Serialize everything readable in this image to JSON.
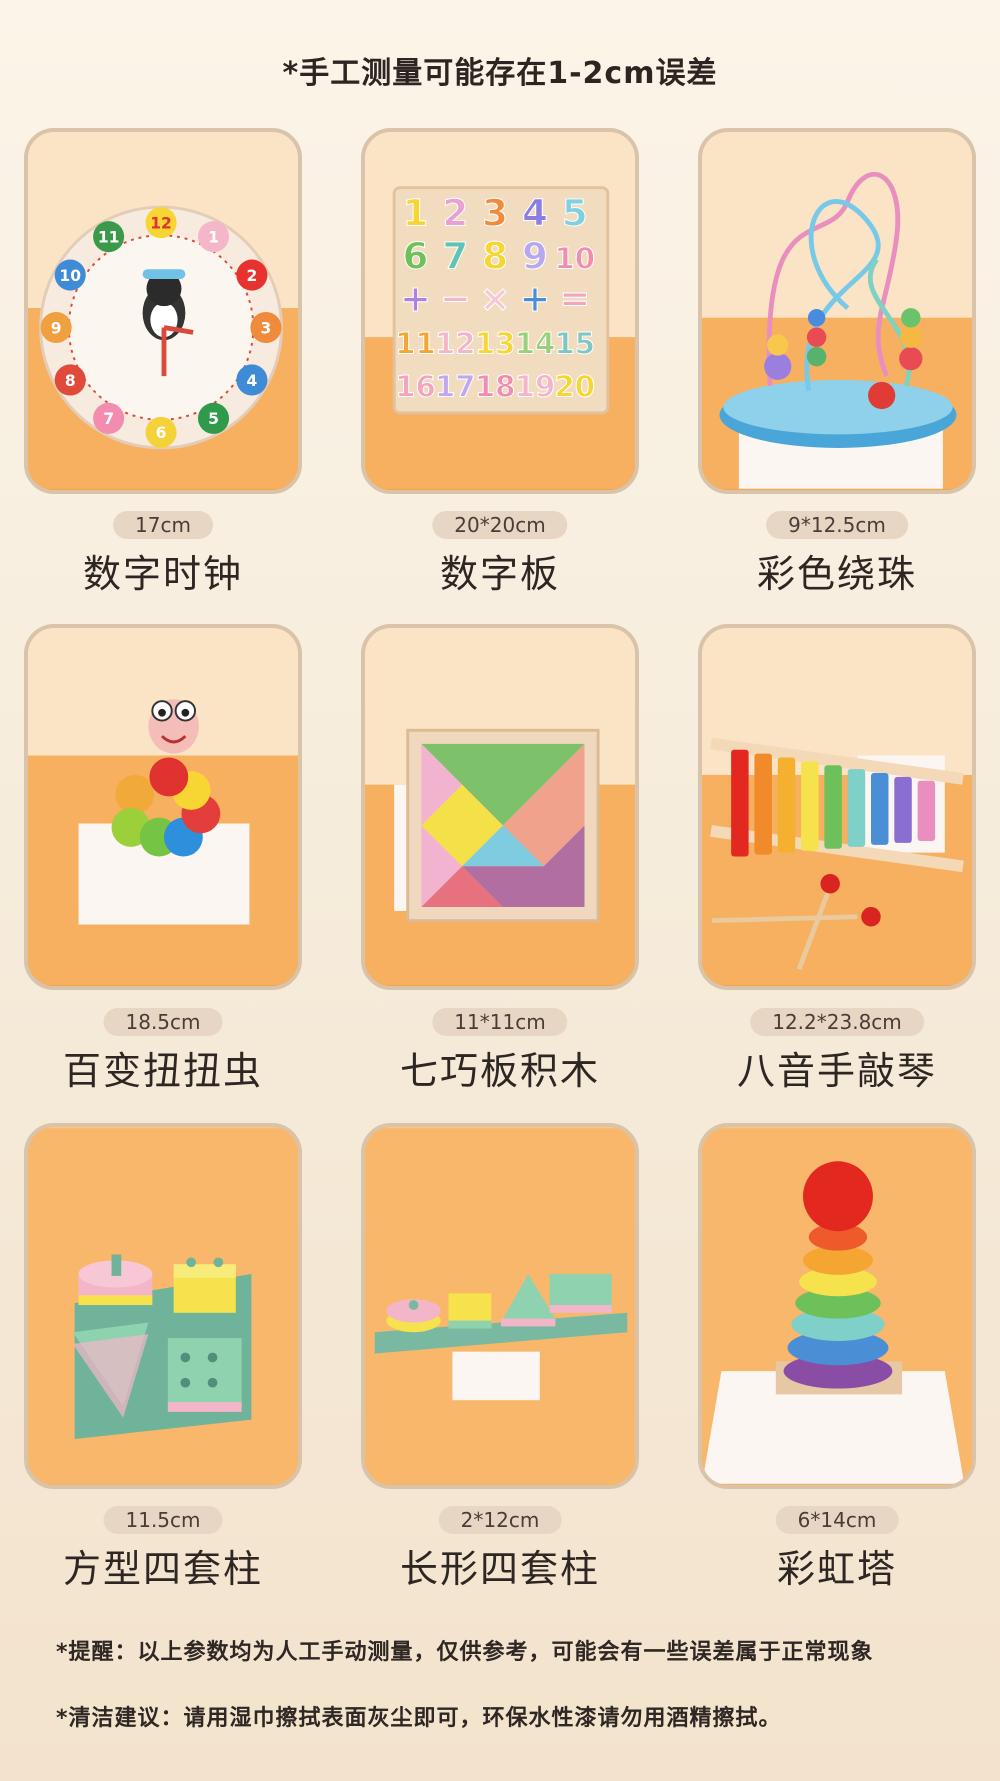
{
  "header": {
    "title": "*手工测量可能存在1-2cm误差"
  },
  "products": [
    {
      "size": "17cm",
      "name": "数字时钟"
    },
    {
      "size": "20*20cm",
      "name": "数字板"
    },
    {
      "size": "9*12.5cm",
      "name": "彩色绕珠"
    },
    {
      "size": "18.5cm",
      "name": "百变扭扭虫"
    },
    {
      "size": "11*11cm",
      "name": "七巧板积木"
    },
    {
      "size": "12.2*23.8cm",
      "name": "八音手敲琴"
    },
    {
      "size": "11.5cm",
      "name": "方型四套柱"
    },
    {
      "size": "2*12cm",
      "name": "长形四套柱"
    },
    {
      "size": "6*14cm",
      "name": "彩虹塔"
    }
  ],
  "clock_numbers": [
    "12",
    "1",
    "2",
    "3",
    "4",
    "5",
    "6",
    "7",
    "8",
    "9",
    "10",
    "11"
  ],
  "board_rows": [
    [
      "1",
      "2",
      "3",
      "4",
      "5"
    ],
    [
      "6",
      "7",
      "8",
      "9",
      "10"
    ],
    [
      "+",
      "−",
      "×",
      "+",
      "="
    ],
    [
      "11",
      "12",
      "13",
      "14",
      "15"
    ],
    [
      "16",
      "17",
      "18",
      "19",
      "20"
    ]
  ],
  "notes": {
    "reminder": "*提醒：以上参数均为人工手动测量，仅供参考，可能会有一些误差属于正常现象",
    "cleaning": "*清洁建议：请用湿巾擦拭表面灰尘即可，环保水性漆请勿用酒精擦拭。"
  },
  "colors": {
    "card_border": "#d9c3a9",
    "badge_bg": "#e8d6c4",
    "orange_table": "#f3a553"
  }
}
